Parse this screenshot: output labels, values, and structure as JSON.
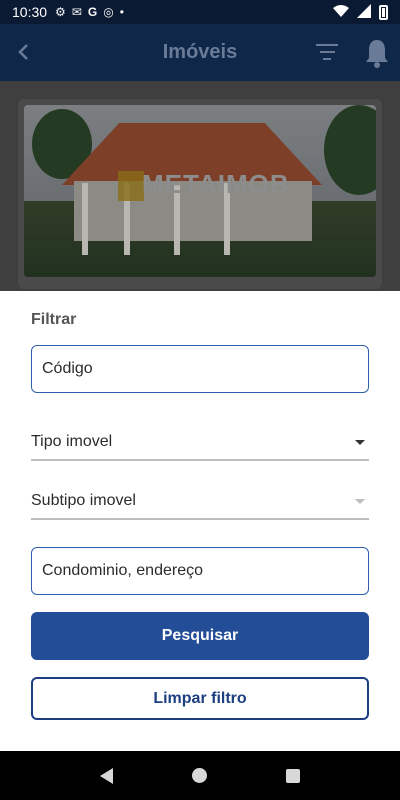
{
  "status_bar": {
    "time": "10:30",
    "icons": [
      "settings-icon",
      "gmail-icon",
      "google-icon",
      "vpn-icon",
      "dot-icon"
    ],
    "right_icons": [
      "wifi-icon",
      "signal-icon",
      "battery-icon"
    ]
  },
  "app_bar": {
    "title": "Imóveis",
    "back_icon": "back-arrow-icon",
    "filter_icon": "filter-icon",
    "bell_icon": "bell-icon"
  },
  "listing": {
    "watermark": "METAIMOB"
  },
  "filter_sheet": {
    "title": "Filtrar",
    "code_field": {
      "placeholder": "Código",
      "value": ""
    },
    "type_dropdown": {
      "label": "Tipo imovel"
    },
    "subtype_dropdown": {
      "label": "Subtipo imovel"
    },
    "address_field": {
      "placeholder": "Condominio, endereço",
      "value": ""
    },
    "search_button": "Pesquisar",
    "clear_button": "Limpar filtro"
  },
  "colors": {
    "primary": "#234d97",
    "appbar": "#0f2748",
    "outline": "#1d3f80"
  }
}
